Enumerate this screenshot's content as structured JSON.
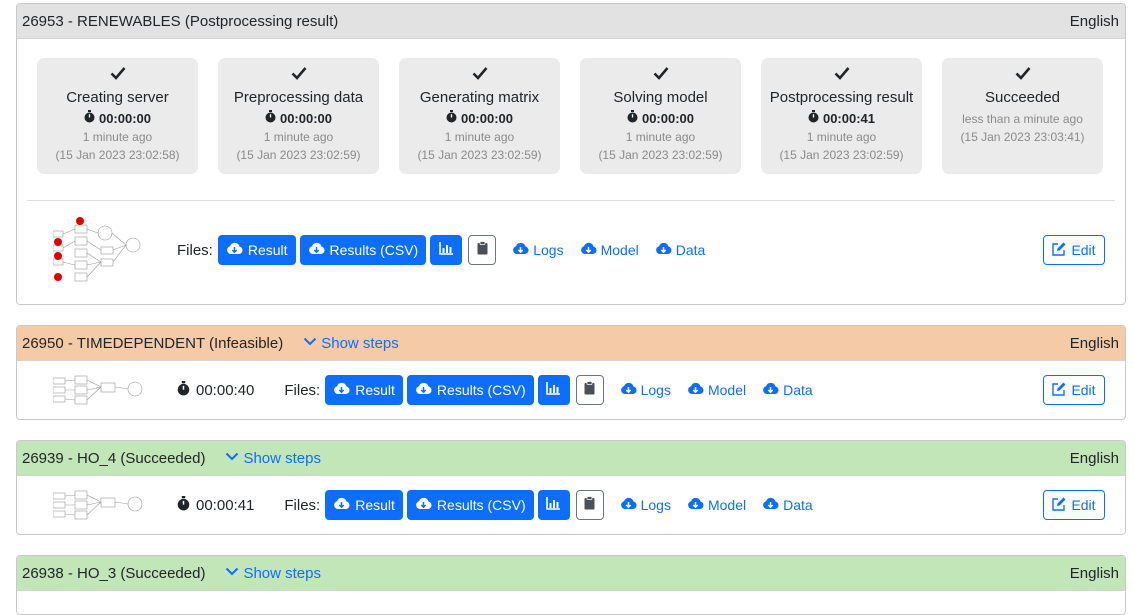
{
  "jobs": [
    {
      "title": "26953 - RENEWABLES (Postprocessing result)",
      "lang": "English",
      "steps": [
        {
          "name": "Creating server",
          "dur": "00:00:00",
          "ago": "1 minute ago",
          "ts": "(15 Jan 2023 23:02:58)"
        },
        {
          "name": "Preprocessing data",
          "dur": "00:00:00",
          "ago": "1 minute ago",
          "ts": "(15 Jan 2023 23:02:59)"
        },
        {
          "name": "Generating matrix",
          "dur": "00:00:00",
          "ago": "1 minute ago",
          "ts": "(15 Jan 2023 23:02:59)"
        },
        {
          "name": "Solving model",
          "dur": "00:00:00",
          "ago": "1 minute ago",
          "ts": "(15 Jan 2023 23:02:59)"
        },
        {
          "name": "Postprocessing result",
          "dur": "00:00:41",
          "ago": "1 minute ago",
          "ts": "(15 Jan 2023 23:02:59)"
        },
        {
          "name": "Succeeded",
          "ago": "less than a minute ago",
          "ts": "(15 Jan 2023 23:03:41)"
        }
      ]
    },
    {
      "title": "26950 - TIMEDEPENDENT (Infeasible)",
      "lang": "English",
      "duration": "00:00:40"
    },
    {
      "title": "26939 - HO_4 (Succeeded)",
      "lang": "English",
      "duration": "00:00:41"
    },
    {
      "title": "26938 - HO_3 (Succeeded)",
      "lang": "English"
    }
  ],
  "labels": {
    "show_steps": "Show steps",
    "files": "Files:",
    "result": "Result",
    "results_csv": "Results (CSV)",
    "logs": "Logs",
    "model": "Model",
    "data": "Data",
    "edit": "Edit"
  },
  "icons": {
    "step_done": "check-icon",
    "duration": "stopwatch-icon",
    "download": "cloud-download-icon",
    "chart": "bar-chart-icon",
    "clipboard": "clipboard-icon",
    "edit": "edit-icon",
    "expand": "chevron-down-icon"
  },
  "colors": {
    "primary": "#0d6efd",
    "header_running": "#e2e2e2",
    "header_infeasible": "#f5cba7",
    "header_succeeded": "#c3e6b8"
  }
}
